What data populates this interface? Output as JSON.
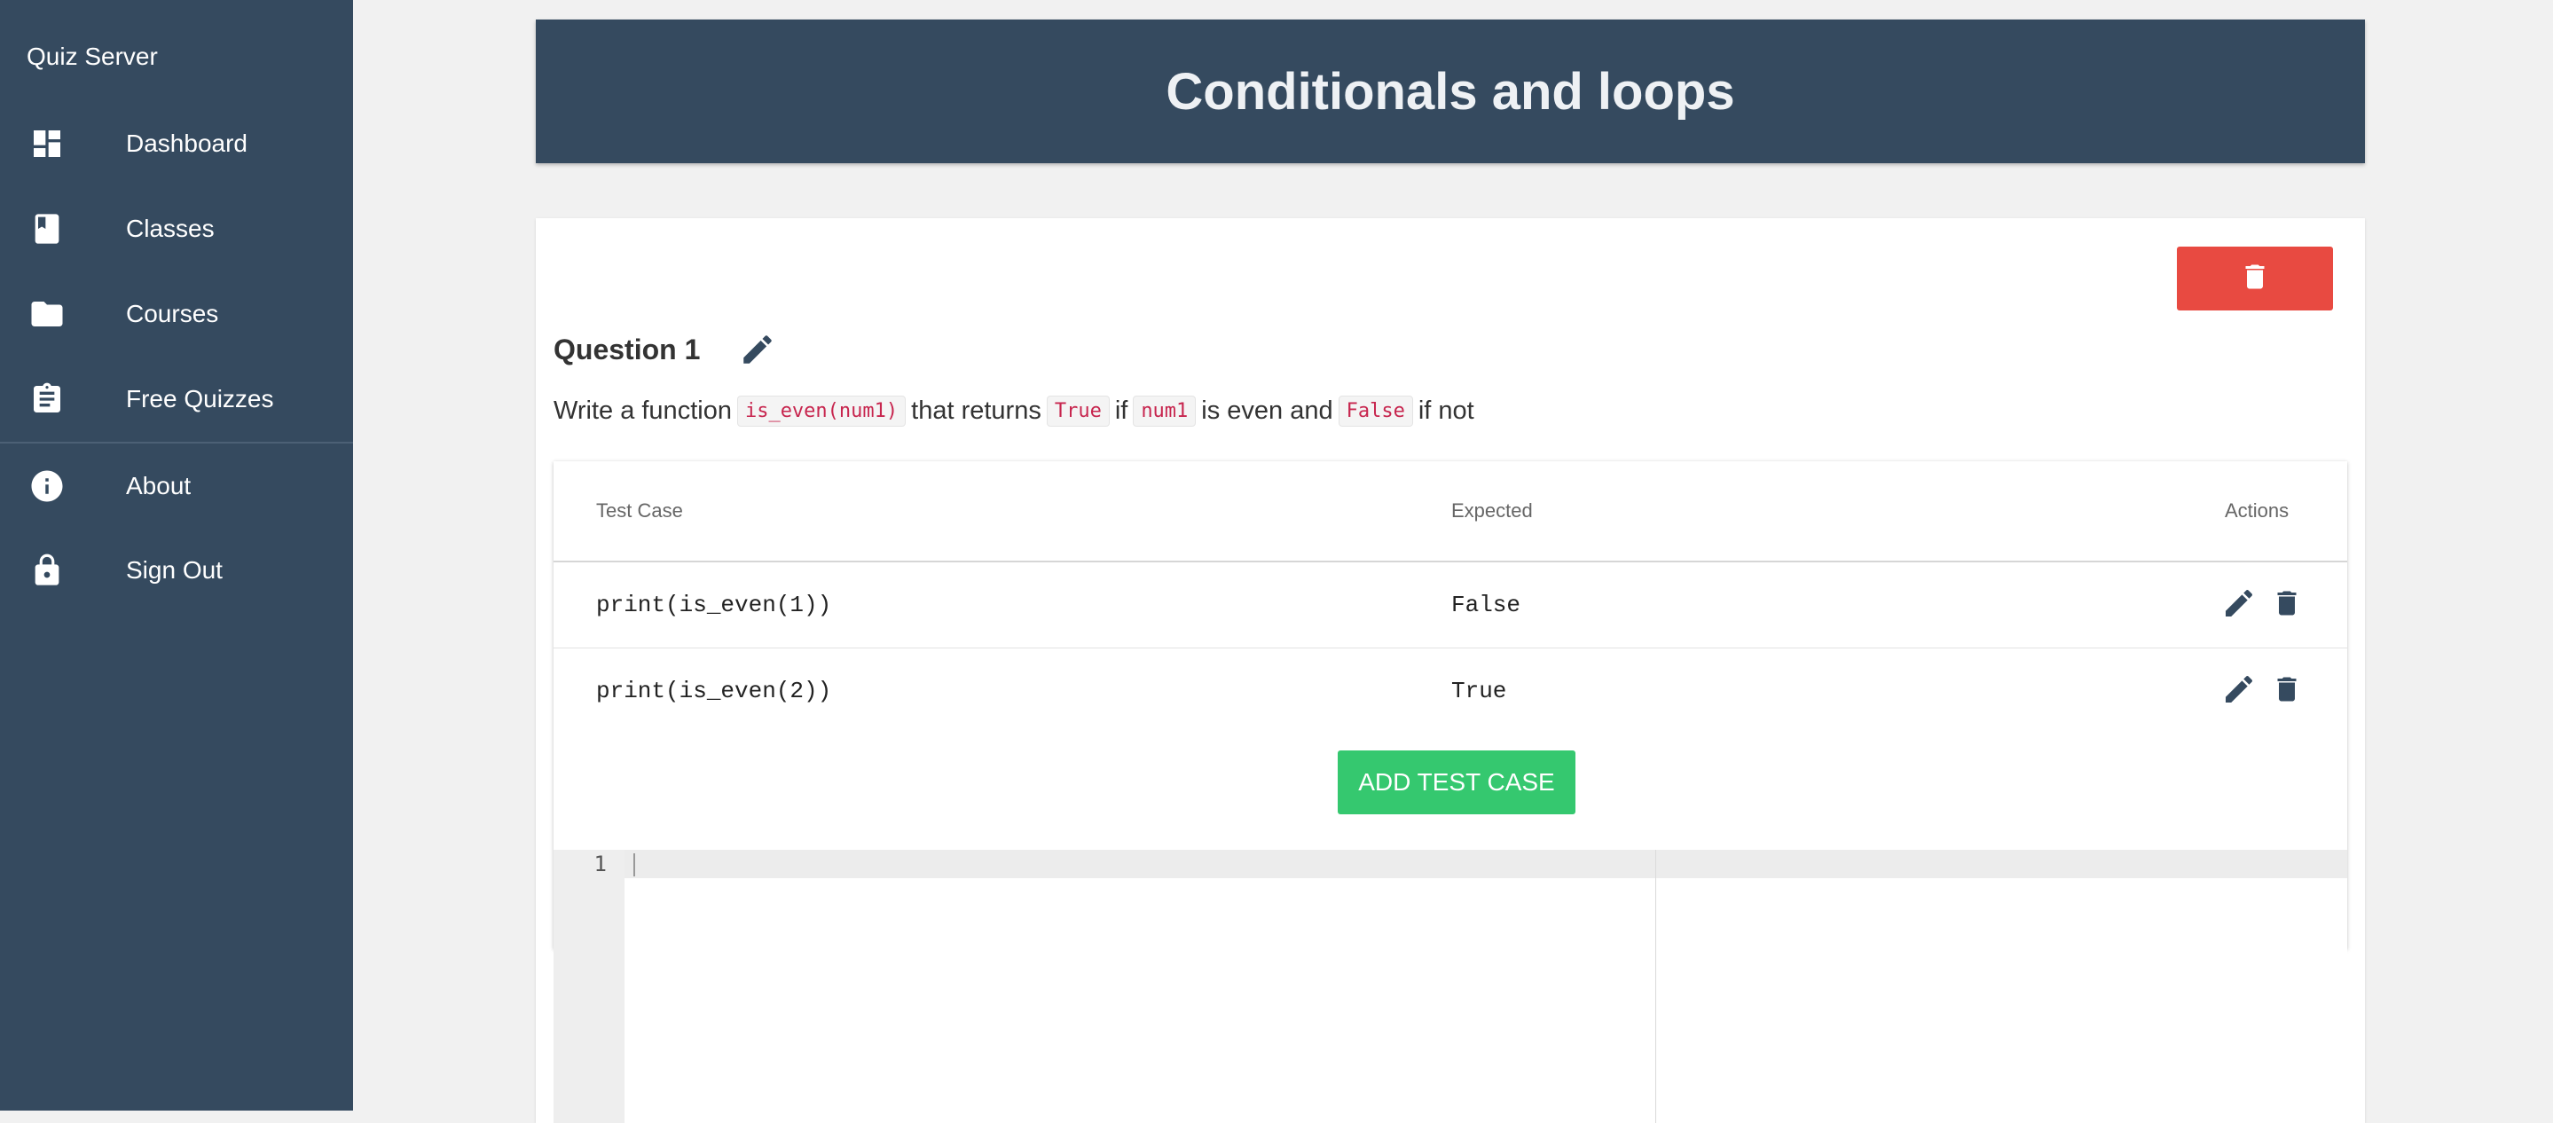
{
  "sidebar": {
    "brand": "Quiz Server",
    "items": [
      {
        "label": "Dashboard",
        "icon": "dashboard-icon"
      },
      {
        "label": "Classes",
        "icon": "book-icon"
      },
      {
        "label": "Courses",
        "icon": "folder-icon"
      },
      {
        "label": "Free Quizzes",
        "icon": "clipboard-icon"
      },
      {
        "label": "About",
        "icon": "info-icon"
      },
      {
        "label": "Sign Out",
        "icon": "lock-icon"
      }
    ]
  },
  "page": {
    "title": "Conditionals and loops"
  },
  "question": {
    "title": "Question 1",
    "text_parts": {
      "p1": "Write a function",
      "c1": "is_even(num1)",
      "p2": "that returns",
      "c2": "True",
      "p3": "if",
      "c3": "num1",
      "p4": "is even and",
      "c4": "False",
      "p5": "if not"
    }
  },
  "test_table": {
    "headers": {
      "test_case": "Test Case",
      "expected": "Expected",
      "actions": "Actions"
    },
    "rows": [
      {
        "test_case": "print(is_even(1))",
        "expected": "False"
      },
      {
        "test_case": "print(is_even(2))",
        "expected": "True"
      }
    ]
  },
  "buttons": {
    "add_test_case": "ADD TEST CASE"
  },
  "editor": {
    "line_numbers": [
      "1"
    ],
    "content": ""
  },
  "colors": {
    "sidebar": "#354a5f",
    "danger": "#e84a41",
    "success": "#35c86f",
    "icon": "#354a5f"
  }
}
